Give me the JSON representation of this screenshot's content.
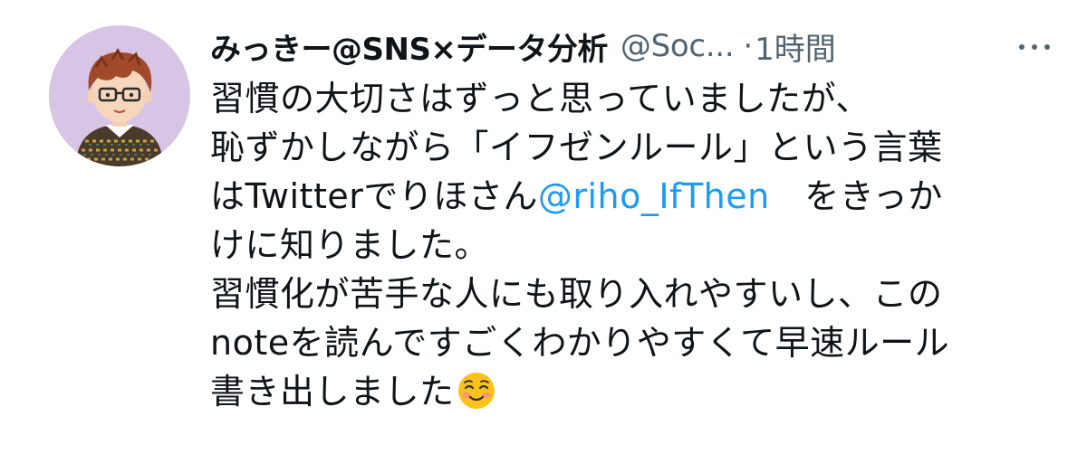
{
  "tweet": {
    "display_name": "みっきー@SNS×データ分析",
    "handle": "@Soc...",
    "separator": "·",
    "time": "1時間",
    "more_icon": "more-horizontal-icon",
    "lines": {
      "l1": "習慣の大切さはずっと思っていましたが、",
      "l2": "恥ずかしながら「イフゼンルール」という言葉",
      "l3_a": "はTwitterでりほさん",
      "l3_mention": "@riho_IfThen",
      "l3_b": "　をきっか",
      "l4": "けに知りました。",
      "l5": "習慣化が苦手な人にも取り入れやすいし、この",
      "l6": "noteを読んですごくわかりやすくて早速ルール",
      "l7": "書き出しました"
    },
    "emoji": "smiling-face-emoji"
  },
  "colors": {
    "text": "#0f1419",
    "secondary": "#536471",
    "link": "#1d9bf0",
    "avatar_bg": "#d8c5e6"
  }
}
